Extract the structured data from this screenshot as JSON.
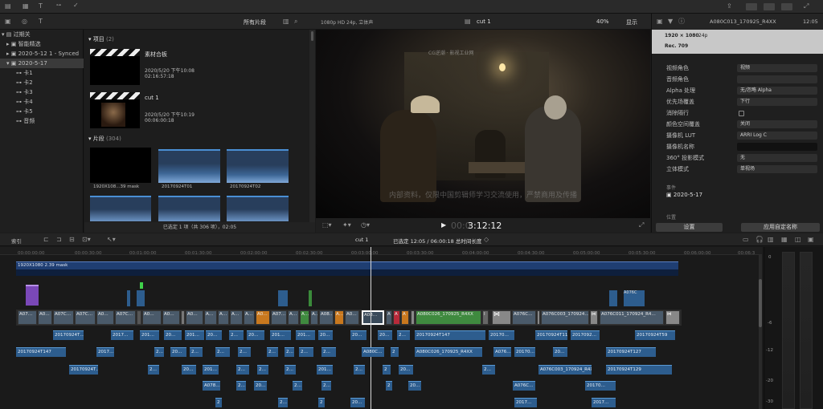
{
  "top_toolbar": {
    "icons": [
      "undo-icon",
      "redo-icon",
      "key-icon",
      "checkmark-icon"
    ]
  },
  "browser_header": {
    "filter": "所有片段",
    "format": "1080p HD 24p, 立体声",
    "clip_name": "cut 1",
    "zoom": "40%",
    "view": "显示"
  },
  "library": {
    "items": [
      {
        "label": "过期关",
        "indent": 0
      },
      {
        "label": "智能精选",
        "indent": 1
      },
      {
        "label": "2020-5-12 1 - Synced",
        "indent": 1
      },
      {
        "label": "2020-5-17",
        "indent": 1,
        "selected": true
      },
      {
        "label": "卡1",
        "indent": 2
      },
      {
        "label": "卡2",
        "indent": 2
      },
      {
        "label": "卡3",
        "indent": 2
      },
      {
        "label": "卡4",
        "indent": 2
      },
      {
        "label": "卡5",
        "indent": 2
      },
      {
        "label": "音频",
        "indent": 2
      }
    ]
  },
  "browser": {
    "projects_section": "项目",
    "projects_count": "(2)",
    "projects": [
      {
        "name": "素材合板",
        "date": "2020/5/20 下午10:08",
        "duration": "02:16:57:18"
      },
      {
        "name": "cut 1",
        "date": "2020/5/20 下午10:19",
        "duration": "00:06:00:18"
      }
    ],
    "clips_section": "片段",
    "clips_count": "(304)",
    "clips": [
      "1920X108...39 mask",
      "20170924T01",
      "20170924T02"
    ],
    "status": "已选定 1 项（共 306 项），02:05"
  },
  "viewer": {
    "watermark_top": "CG逆潮 · 影视工业网",
    "subtitle": "内部资料，仅限中国剪辑师学习交流使用，严禁商用及传播",
    "timecode": "3:12:12",
    "timecode_prefix": "00:0"
  },
  "inspector": {
    "clip_id": "A080C013_170925_R4XX",
    "time": "12:05",
    "resolution": "1920 × 1080",
    "fps": "24p",
    "rec": "Rec. 709",
    "rows": [
      {
        "label": "视频角色",
        "value": "视频"
      },
      {
        "label": "音频角色",
        "value": ""
      },
      {
        "label": "Alpha 处理",
        "value": "无/忽略 Alpha"
      },
      {
        "label": "优先场覆盖",
        "value": "下行"
      },
      {
        "label": "消除隔行",
        "value": ""
      },
      {
        "label": "颜色空间覆盖",
        "value": "关闭"
      },
      {
        "label": "摄像机 LUT",
        "value": "ARRI Log C"
      },
      {
        "label": "摄像机名称",
        "value": ""
      },
      {
        "label": "360° 投影模式",
        "value": "无"
      },
      {
        "label": "立体模式",
        "value": "单视场"
      }
    ],
    "location_label": "事件",
    "location": "2020-5-17",
    "position_label": "位置",
    "settings_btn": "设置",
    "apply_btn": "应用自定名称"
  },
  "timeline": {
    "index_label": "索引",
    "project": "cut 1",
    "selection_info": "已选定 12:05 / 06:00:18 总时间长度",
    "ruler": [
      "00:00:00:00",
      "00:00:30:00",
      "00:01:00:00",
      "00:01:30:00",
      "00:02:00:00",
      "00:02:30:00",
      "00:03:00:00",
      "00:03:30:00",
      "00:04:00:00",
      "00:04:30:00",
      "00:05:00:00",
      "00:05:30:00",
      "00:06:00:00",
      "00:06:3"
    ],
    "title_clip": "1920X1080 2.39 mask",
    "meter_scale": [
      "0",
      "-6",
      "-12",
      "-20",
      "-30"
    ]
  }
}
